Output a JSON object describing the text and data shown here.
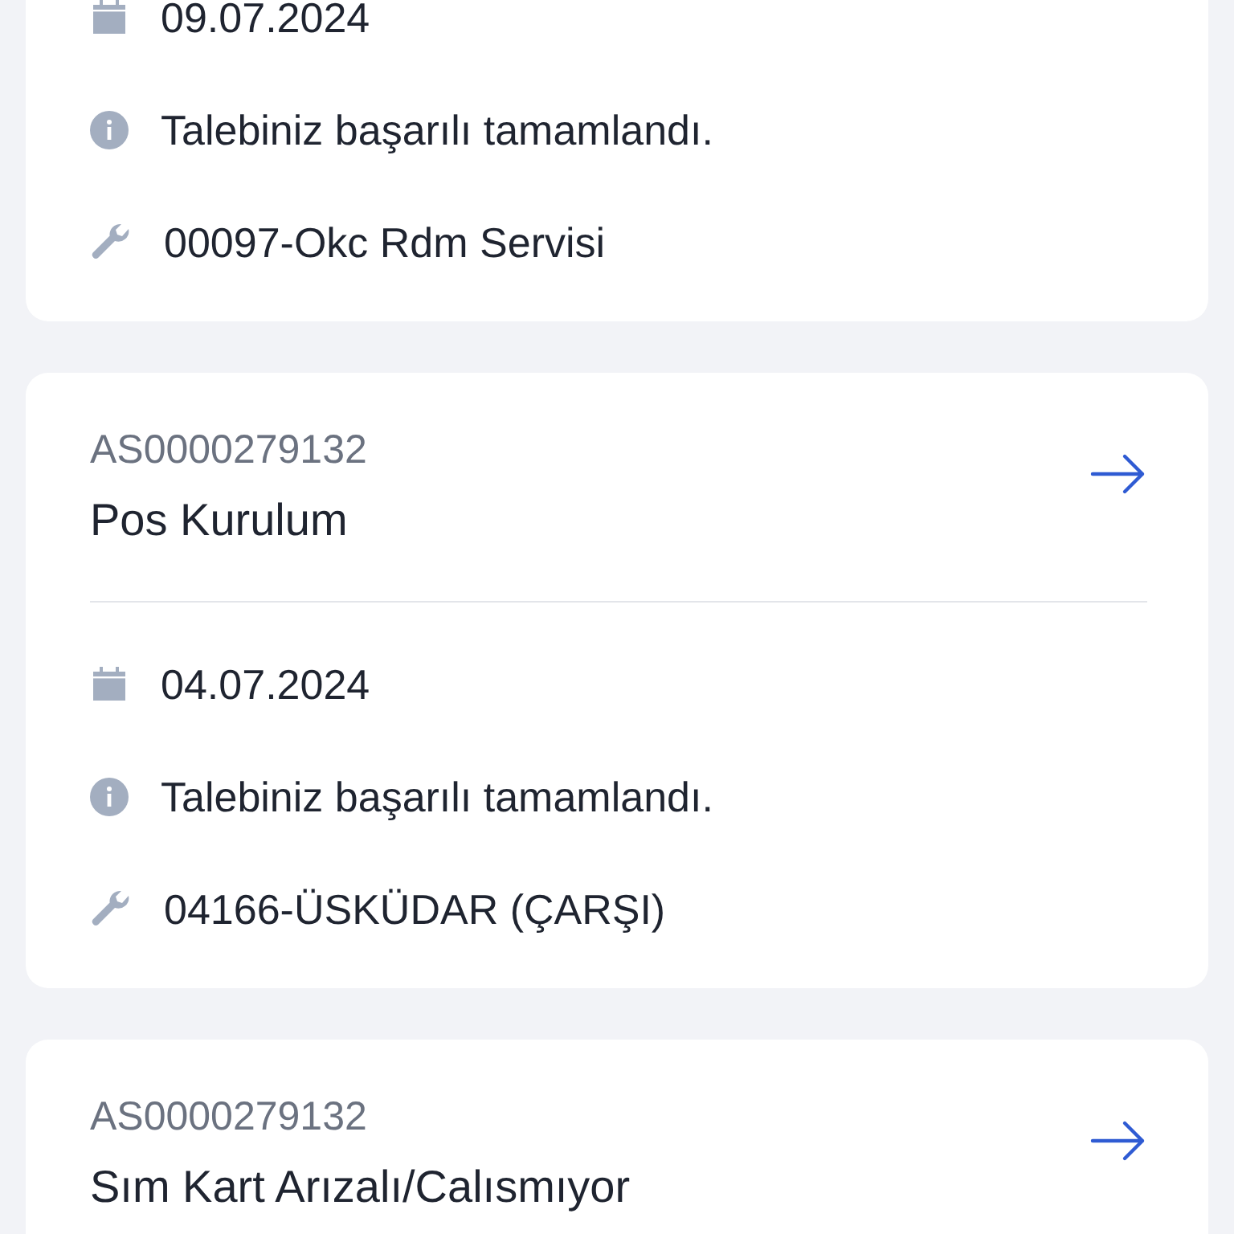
{
  "requests": [
    {
      "details": [
        {
          "kind": "date",
          "text": "09.07.2024"
        },
        {
          "kind": "status",
          "text": "Talebiniz başarılı tamamlandı."
        },
        {
          "kind": "service",
          "text": "00097-Okc Rdm Servisi"
        }
      ]
    },
    {
      "code": "AS0000279132",
      "title": "Pos Kurulum",
      "details": [
        {
          "kind": "date",
          "text": "04.07.2024"
        },
        {
          "kind": "status",
          "text": "Talebiniz başarılı tamamlandı."
        },
        {
          "kind": "service",
          "text": "04166-ÜSKÜDAR (ÇARŞI)"
        }
      ]
    },
    {
      "code": "AS0000279132",
      "title": "Sım Kart Arızalı/Calısmıyor"
    }
  ]
}
